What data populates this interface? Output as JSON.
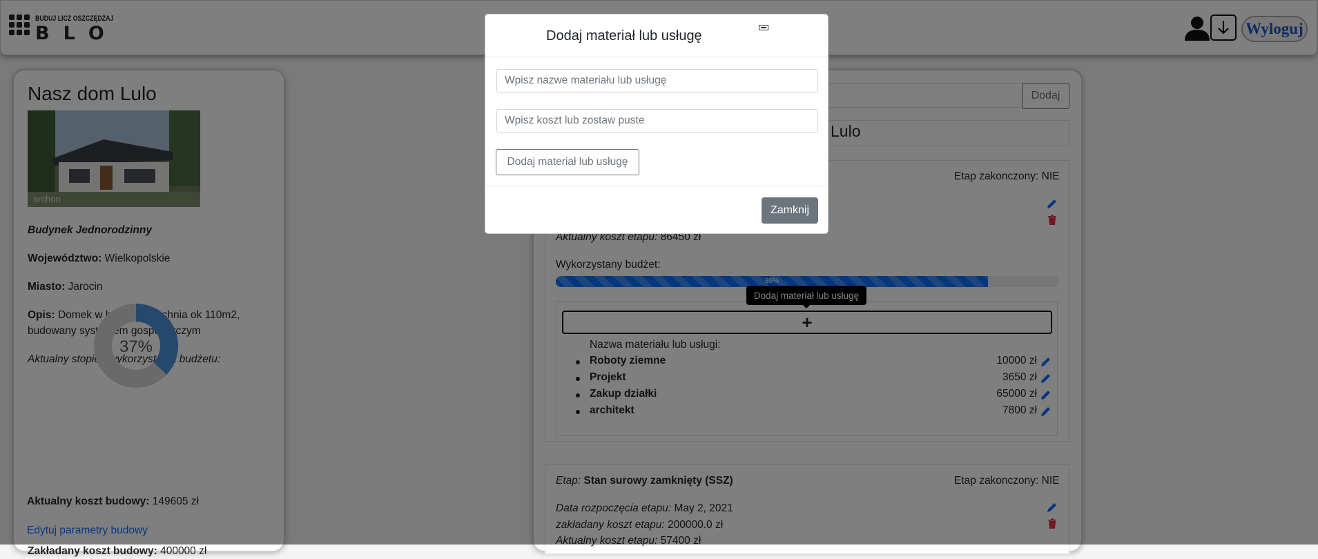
{
  "header": {
    "logo_top": "BUDUJ LICZ OSZCZĘDZAJ",
    "logo_main": "BLO",
    "logout_label": "Wyloguj"
  },
  "project": {
    "name": "Nasz dom Lulo",
    "image_caption": "archon",
    "type": "Budynek Jednorodzinny",
    "voivodeship_label": "Województwo:",
    "voivodeship": "Wielkopolskie",
    "city_label": "Miasto:",
    "city": "Jarocin",
    "desc_label": "Opis:",
    "desc": "Domek w lulo powierzchnia ok 110m2, budowany systemem gospodarczym",
    "budget_usage_label": "Aktualny stopień wykorzystania budżetu:",
    "budget_usage_percent": 37,
    "budget_usage_text": "37%",
    "planned_cost_label": "Zakładany koszt budowy:",
    "planned_cost": "400000 zł",
    "current_cost_label": "Aktualny koszt budowy:",
    "current_cost": "149605 zł",
    "edit_link": "Edytuj parametry budowy"
  },
  "main": {
    "add_button": "Dodaj",
    "title_fragment": "Lulo",
    "stage1": {
      "finished_label": "Etap zakonczony: NIE",
      "current_cost_label": "Aktualny koszt etapu:",
      "current_cost": "86450 zł",
      "budget_used_label": "Wykorzystany budżet:",
      "budget_used_percent": 86,
      "budget_used_text": "86%",
      "add_material_symbol": "+",
      "materials_header": "Nazwa materiału lub usługi:",
      "materials": [
        {
          "name": "Roboty ziemne",
          "cost": "10000 zł"
        },
        {
          "name": "Projekt",
          "cost": "3650 zł"
        },
        {
          "name": "Zakup działki",
          "cost": "65000 zł"
        },
        {
          "name": "architekt",
          "cost": "7800 zł"
        }
      ]
    },
    "stage2": {
      "stage_label": "Etap:",
      "stage_name": "Stan surowy zamknięty (SSZ)",
      "finished_label": "Etap zakonczony: NIE",
      "start_label": "Data rozpoczęcia etapu:",
      "start_date": "May 2, 2021",
      "planned_label": "zakładany koszt etapu:",
      "planned_cost": "200000.0 zł",
      "current_cost_label": "Aktualny koszt etapu:",
      "current_cost": "57400 zł"
    }
  },
  "tooltip": {
    "text": "Dodaj materiał lub usługę"
  },
  "modal": {
    "title": "Dodaj materiał lub usługę",
    "name_placeholder": "Wpisz nazwe materiału lub usługę",
    "cost_placeholder": "Wpisz koszt lub zostaw puste",
    "add_button": "Dodaj materiał lub usługę",
    "close_button": "Zamknij"
  },
  "colors": {
    "accent_blue": "#1a55c2",
    "delete_red": "#dc3545",
    "progress_blue": "#0d6efd",
    "donut_fill": "#4a90d9",
    "donut_bg": "#d4d4d4"
  }
}
